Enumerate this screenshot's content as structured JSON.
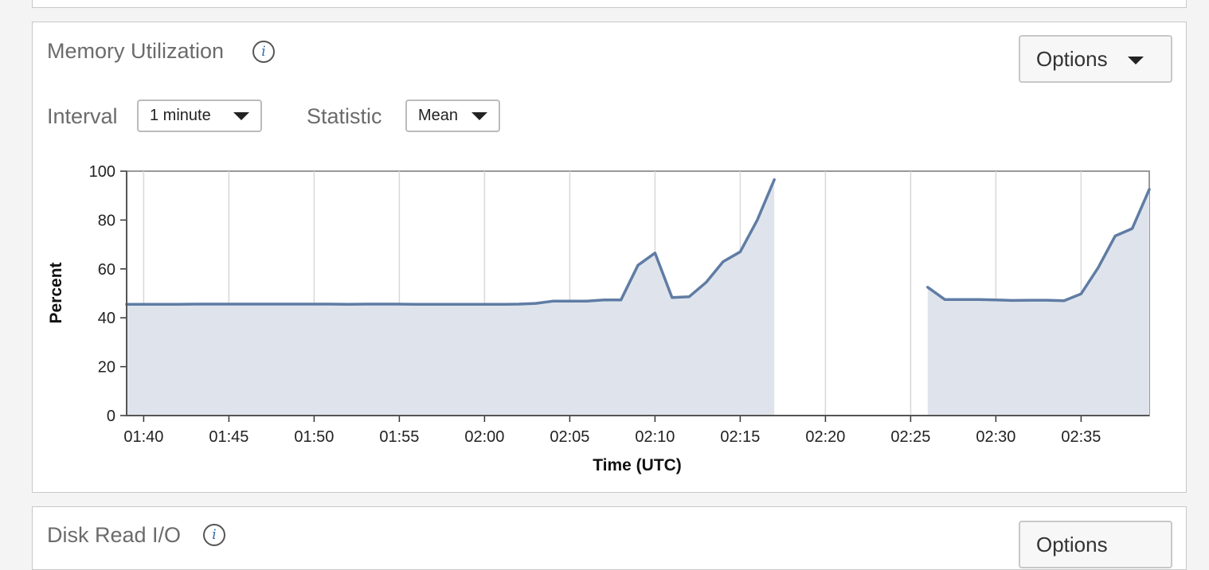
{
  "panel": {
    "title": "Memory Utilization",
    "info_glyph": "i",
    "options_label": "Options",
    "interval_label": "Interval",
    "interval_value": "1 minute",
    "statistic_label": "Statistic",
    "statistic_value": "Mean"
  },
  "next_panel": {
    "title": "Disk Read I/O",
    "options_label": "Options"
  },
  "colors": {
    "line": "#5f7ca4",
    "fill": "#dfe4ec",
    "grid": "#d8d8d8",
    "axis": "#999999"
  },
  "chart_data": {
    "type": "area",
    "xlabel": "Time (UTC)",
    "ylabel": "Percent",
    "ylim": [
      0,
      100
    ],
    "yticks": [
      0,
      20,
      40,
      60,
      80,
      100
    ],
    "xlim": [
      "01:39",
      "02:39"
    ],
    "xticks": [
      "01:40",
      "01:45",
      "01:50",
      "01:55",
      "02:00",
      "02:05",
      "02:10",
      "02:15",
      "02:20",
      "02:25",
      "02:30",
      "02:35"
    ],
    "grid": true,
    "series": [
      {
        "segments": [
          {
            "x": [
              "01:39",
              "01:40",
              "01:41",
              "01:42",
              "01:43",
              "01:44",
              "01:45",
              "01:46",
              "01:47",
              "01:48",
              "01:49",
              "01:50",
              "01:51",
              "01:52",
              "01:53",
              "01:54",
              "01:55",
              "01:56",
              "01:57",
              "01:58",
              "01:59",
              "02:00",
              "02:01",
              "02:02",
              "02:03",
              "02:04",
              "02:05",
              "02:06",
              "02:07",
              "02:08",
              "02:09",
              "02:10",
              "02:11",
              "02:12",
              "02:13",
              "02:14",
              "02:15",
              "02:16",
              "02:17"
            ],
            "y": [
              45.5,
              45.5,
              45.5,
              45.5,
              45.6,
              45.6,
              45.6,
              45.6,
              45.6,
              45.6,
              45.6,
              45.6,
              45.6,
              45.5,
              45.6,
              45.6,
              45.6,
              45.5,
              45.5,
              45.5,
              45.5,
              45.5,
              45.5,
              45.6,
              45.9,
              46.8,
              46.8,
              46.8,
              47.3,
              47.3,
              61.5,
              66.5,
              48.3,
              48.6,
              54.5,
              63.0,
              67.0,
              80.0,
              96.5
            ]
          },
          {
            "x": [
              "02:26",
              "02:27",
              "02:28",
              "02:29",
              "02:30",
              "02:31",
              "02:32",
              "02:33",
              "02:34",
              "02:35",
              "02:36",
              "02:37",
              "02:38",
              "02:39"
            ],
            "y": [
              52.5,
              47.5,
              47.5,
              47.5,
              47.3,
              47.1,
              47.2,
              47.2,
              47.0,
              49.8,
              60.5,
              73.5,
              76.5,
              92.5
            ]
          }
        ]
      }
    ]
  }
}
